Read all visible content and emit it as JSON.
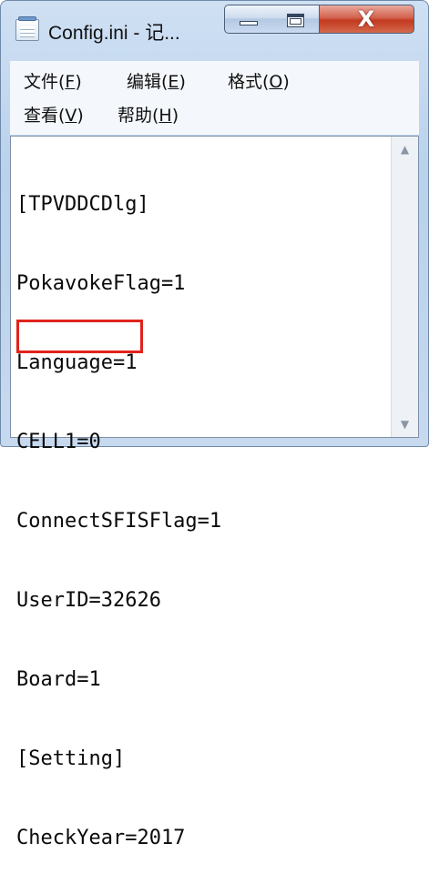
{
  "window": {
    "title": "Config.ini - 记...",
    "close_glyph": "X"
  },
  "menu": {
    "items": [
      {
        "label": "文件(",
        "mnemonic": "F",
        "suffix": ")"
      },
      {
        "label": "编辑(",
        "mnemonic": "E",
        "suffix": ")"
      },
      {
        "label": "格式(",
        "mnemonic": "O",
        "suffix": ")"
      },
      {
        "label": "查看(",
        "mnemonic": "V",
        "suffix": ")"
      },
      {
        "label": "帮助(",
        "mnemonic": "H",
        "suffix": ")"
      }
    ]
  },
  "editor": {
    "lines": [
      "[TPVDDCDlg]",
      "PokavokeFlag=1",
      "Language=1",
      "CELL1=0",
      "ConnectSFISFlag=1",
      "UserID=32626",
      "Board=1",
      "[Setting]",
      "CheckYear=2017"
    ],
    "highlight_color": "#e0231c"
  },
  "scrollbar": {
    "up_arrow": "▲",
    "down_arrow": "▼"
  }
}
